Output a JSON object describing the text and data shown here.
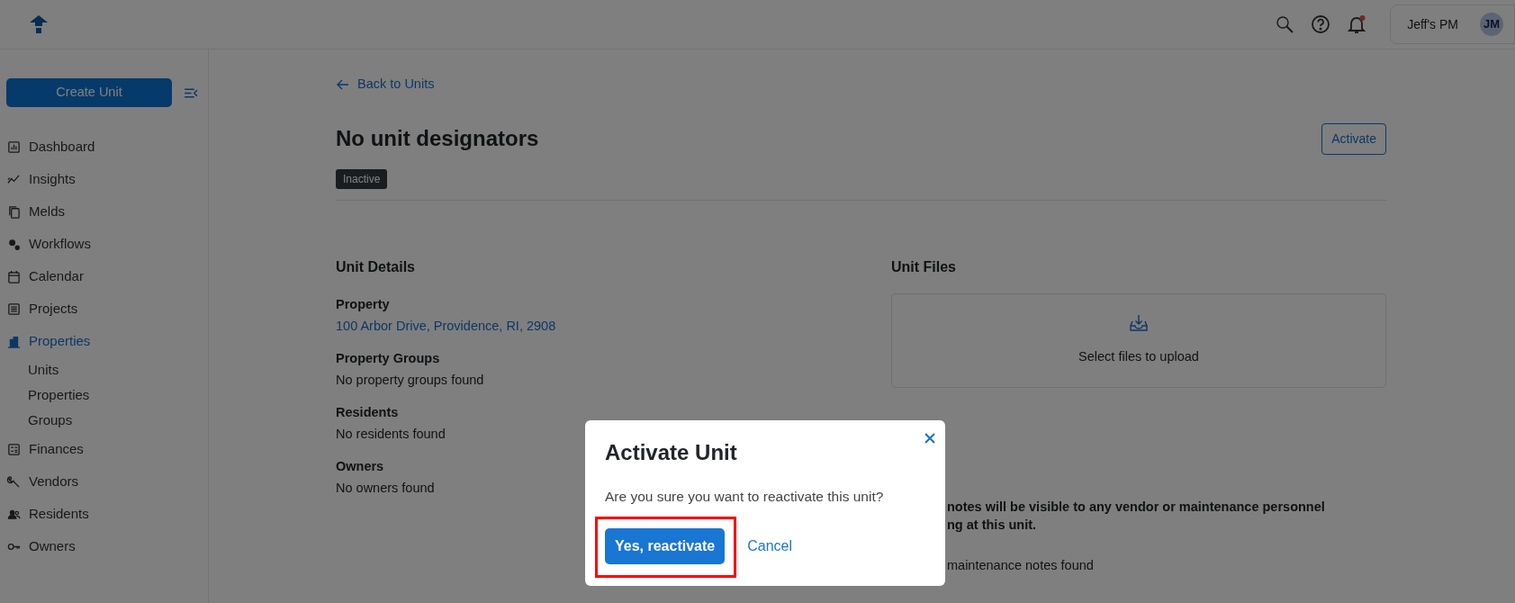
{
  "header": {
    "actions": [
      {
        "kind": "search"
      },
      {
        "kind": "help"
      },
      {
        "kind": "notifications",
        "unread": true
      }
    ],
    "account": {
      "name": "Jeff's PM",
      "initials": "JM"
    }
  },
  "sidebar": {
    "create_button": "Create Unit",
    "items": [
      {
        "label": "Dashboard",
        "selected": false
      },
      {
        "label": "Insights",
        "selected": false
      },
      {
        "label": "Melds",
        "selected": false
      },
      {
        "label": "Workflows",
        "selected": false
      },
      {
        "label": "Calendar",
        "selected": false
      },
      {
        "label": "Projects",
        "selected": false
      },
      {
        "label": "Properties",
        "selected": true,
        "children": [
          {
            "label": "Units",
            "selected": false
          },
          {
            "label": "Properties",
            "selected": false
          },
          {
            "label": "Groups",
            "selected": false
          }
        ]
      },
      {
        "label": "Finances",
        "selected": false
      },
      {
        "label": "Vendors",
        "selected": false
      },
      {
        "label": "Residents",
        "selected": false
      },
      {
        "label": "Owners",
        "selected": false
      }
    ]
  },
  "page": {
    "back_link": "Back to Units",
    "title": "No unit designators",
    "status_badge": "Inactive",
    "action_button": "Activate",
    "unit_details": {
      "heading": "Unit Details",
      "fields": [
        {
          "label": "Property",
          "value": "100 Arbor Drive, Providence, RI, 2908",
          "kind": "link"
        },
        {
          "label": "Property Groups",
          "value": "No property groups found",
          "kind": "text"
        },
        {
          "label": "Residents",
          "value": "No residents found",
          "kind": "text"
        },
        {
          "label": "Owners",
          "value": "No owners found",
          "kind": "text"
        }
      ]
    },
    "unit_files": {
      "heading": "Unit Files",
      "upload_text": "Select files to upload"
    },
    "notes": {
      "lines": [
        "notes will be visible to any vendor or maintenance personnel",
        "ng at this unit."
      ],
      "empty_text": "maintenance notes found"
    }
  },
  "modal": {
    "title": "Activate Unit",
    "message": "Are you sure you want to reactivate this unit?",
    "buttons": [
      {
        "label": "Yes, reactivate",
        "kind": "primary",
        "highlighted": true
      },
      {
        "label": "Cancel",
        "kind": "link",
        "highlighted": false
      }
    ]
  }
}
